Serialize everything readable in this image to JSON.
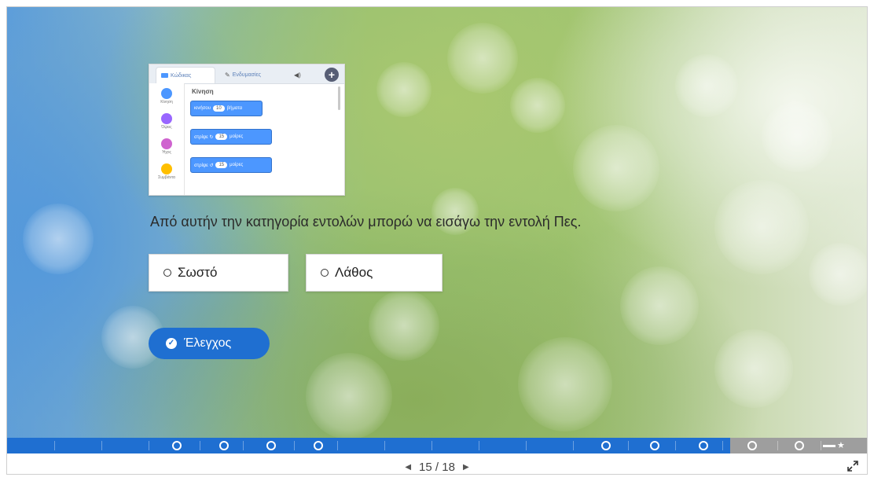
{
  "slide": {
    "question": "Από αυτήν την κατηγορία εντολών μπορώ να εισάγω την εντολή Πες.",
    "answers": [
      "Σωστό",
      "Λάθος"
    ],
    "check_label": "Έλεγχος"
  },
  "scratch_thumbnail": {
    "tabs": [
      "Κώδικας",
      "Ενδυμασίες"
    ],
    "palette_title": "Κίνηση",
    "categories": [
      {
        "label": "Κίνηση",
        "color": "#4c97ff"
      },
      {
        "label": "Όψεις",
        "color": "#9966ff"
      },
      {
        "label": "Ήχος",
        "color": "#cf63cf"
      },
      {
        "label": "Συμβάντα",
        "color": "#ffbf00"
      }
    ],
    "blocks": [
      {
        "prefix": "κινήσου",
        "value": "10",
        "suffix": "βήματα"
      },
      {
        "prefix": "στρίψε ↻",
        "value": "15",
        "suffix": "μοίρες"
      },
      {
        "prefix": "στρίψε ↺",
        "value": "15",
        "suffix": "μοίρες"
      }
    ]
  },
  "progress": {
    "current": 15,
    "total": 18,
    "active_color": "#1f6fd1",
    "inactive_color": "#9e9e9e"
  },
  "navigation": {
    "page_current": "15",
    "separator": "/",
    "page_total": "18"
  }
}
